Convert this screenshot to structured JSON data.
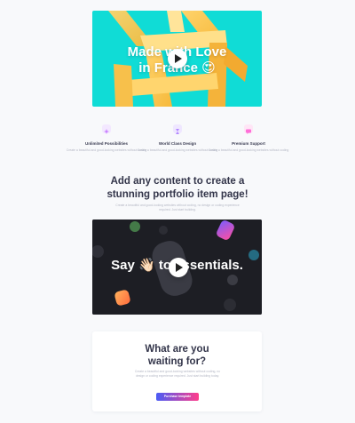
{
  "hero_video": {
    "title_line1": "Made with Love",
    "title_line2": "in France 😍"
  },
  "features": [
    {
      "title": "Unlimited Possibilities",
      "desc": "Create a beautiful and good-looking websites without coding",
      "icon": "sparkle-icon",
      "color": "#c77dff"
    },
    {
      "title": "World Class Design",
      "desc": "Create a beautiful and good-looking websites without coding",
      "icon": "hourglass-icon",
      "color": "#b388ff"
    },
    {
      "title": "Premium Support",
      "desc": "Create a beautiful and good-looking websites without coding",
      "icon": "chat-icon",
      "color": "#ff6fd8"
    }
  ],
  "headline": {
    "line1": "Add any content to create a",
    "line2": "stunning portfolio item page!",
    "subtext": "Create a beautiful and good-looking websites without coding, no design or coding experience required. Just start building."
  },
  "video2": {
    "title": "Say 👋🏻 to essentials."
  },
  "cta": {
    "title_line1": "What are you",
    "title_line2": "waiting for?",
    "desc": "Create a beautiful and good-looking websites without coding, no design or coding experience required. Just start building today.",
    "button_label": "Purchase template"
  },
  "colors": {
    "hero_bg": "#10dcd6",
    "accent_gradient_start": "#4a5cf5",
    "accent_gradient_end": "#ff3d8b",
    "dark_bg": "#1d1e24"
  }
}
